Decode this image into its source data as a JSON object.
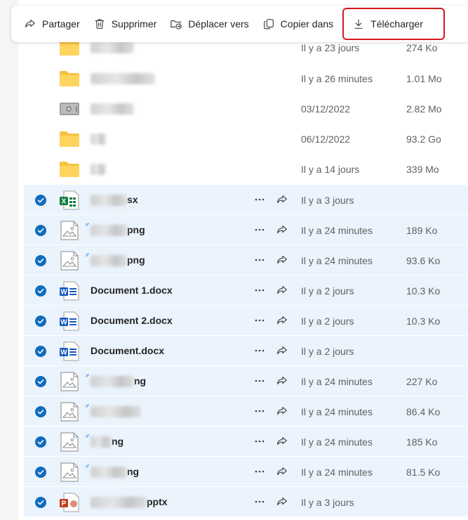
{
  "toolbar": {
    "share_label": "Partager",
    "delete_label": "Supprimer",
    "move_label": "Déplacer vers",
    "copy_label": "Copier dans",
    "download_label": "Télécharger"
  },
  "colors": {
    "selected_row": "#ebf3fc",
    "check_blue": "#0f6cbd",
    "folder_yellow": "#f5c242",
    "highlight_red": "#d6181f",
    "excel_green": "#107c41",
    "word_blue": "#185abd",
    "ppt_red": "#c43e1c"
  },
  "files": [
    {
      "name_suffix": "",
      "modified": "Il y a 23 jours",
      "size": "274 Ko",
      "icon": "folder-icon",
      "selected": false
    },
    {
      "name_suffix": "",
      "modified": "Il y a 26 minutes",
      "size": "1.01 Mo",
      "icon": "folder-icon",
      "selected": false
    },
    {
      "name_suffix": "",
      "modified": "03/12/2022",
      "size": "2.82 Mo",
      "icon": "vault-icon",
      "selected": false
    },
    {
      "name_suffix": "",
      "modified": "06/12/2022",
      "size": "93.2 Go",
      "icon": "folder-icon",
      "selected": false
    },
    {
      "name_suffix": "",
      "modified": "Il y a 14 jours",
      "size": "339 Mo",
      "icon": "folder-icon",
      "selected": false
    },
    {
      "name_suffix": "sx",
      "modified": "Il y a 3 jours",
      "size": "",
      "icon": "excel-icon",
      "selected": true
    },
    {
      "name_suffix": "png",
      "modified": "Il y a 24 minutes",
      "size": "189 Ko",
      "icon": "image-icon",
      "selected": true
    },
    {
      "name_suffix": "png",
      "modified": "Il y a 24 minutes",
      "size": "93.6 Ko",
      "icon": "image-icon",
      "selected": true
    },
    {
      "name": "Document 1.docx",
      "modified": "Il y a 2 jours",
      "size": "10.3 Ko",
      "icon": "word-icon",
      "selected": true
    },
    {
      "name": "Document 2.docx",
      "modified": "Il y a 2 jours",
      "size": "10.3 Ko",
      "icon": "word-icon",
      "selected": true
    },
    {
      "name": "Document.docx",
      "modified": "Il y a 2 jours",
      "size": "",
      "icon": "word-icon",
      "selected": true
    },
    {
      "name_suffix": "ng",
      "modified": "Il y a 24 minutes",
      "size": "227 Ko",
      "icon": "image-icon",
      "selected": true
    },
    {
      "name_suffix": "",
      "modified": "Il y a 24 minutes",
      "size": "86.4 Ko",
      "icon": "image-icon",
      "selected": true
    },
    {
      "name_suffix": "ng",
      "modified": "Il y a 24 minutes",
      "size": "185 Ko",
      "icon": "image-icon",
      "selected": true
    },
    {
      "name_suffix": "ng",
      "modified": "Il y a 24 minutes",
      "size": "81.5 Ko",
      "icon": "image-icon",
      "selected": true
    },
    {
      "name_suffix": "pptx",
      "modified": "Il y a 3 jours",
      "size": "",
      "icon": "powerpoint-icon",
      "selected": true
    }
  ]
}
